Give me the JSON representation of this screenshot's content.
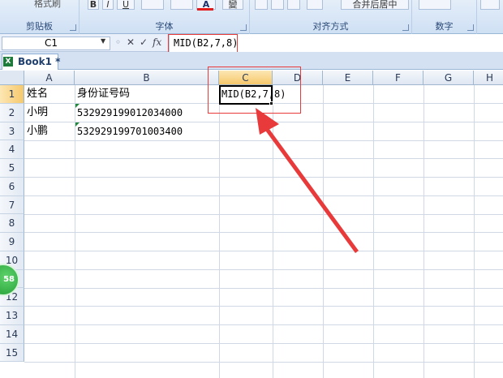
{
  "ribbon": {
    "format_painter": "格式刷",
    "group_clipboard": "剪贴板",
    "group_font": "字体",
    "group_alignment": "对齐方式",
    "group_number": "数字",
    "merge_center": "合并后居中",
    "bold": "B",
    "italic": "I",
    "underline": "U",
    "font_color_letter": "A",
    "phonetic": "變"
  },
  "formula_bar": {
    "name_box": "C1",
    "formula": "MID(B2,7,8)",
    "fx": "fx"
  },
  "workbook_tab": {
    "label": "Book1 *",
    "icon_letter": "X"
  },
  "columns": [
    "A",
    "B",
    "C",
    "D",
    "E",
    "F",
    "G",
    "H"
  ],
  "rows": [
    "1",
    "2",
    "3",
    "4",
    "5",
    "6",
    "7",
    "8",
    "9",
    "10",
    "11",
    "12",
    "13",
    "14",
    "15"
  ],
  "cells": {
    "a1": "姓名",
    "b1": "身份证号码",
    "c1": "MID(B2,7,8)",
    "a2": "小明",
    "b2": "532929199012034000",
    "a3": "小鹏",
    "b3": "532929199701003400"
  },
  "badge": {
    "label": "58"
  },
  "colors": {
    "annotation_red": "#e83a3a",
    "active_header": "#f6c86b",
    "badge_green": "#2fb145"
  }
}
